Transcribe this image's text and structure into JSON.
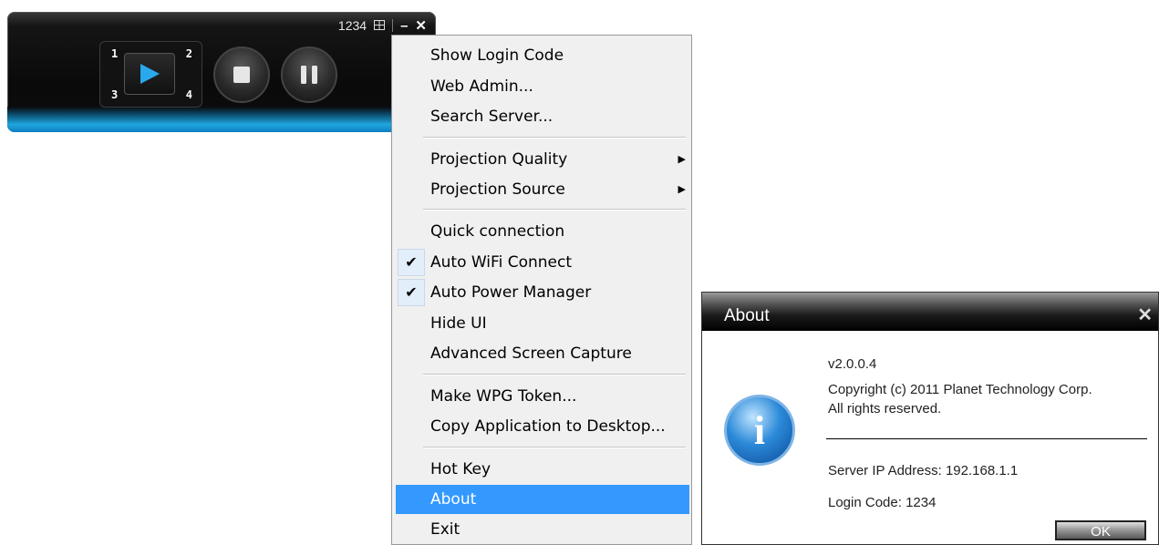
{
  "toolbar": {
    "login_code": "1234",
    "grid_numbers": [
      "1",
      "2",
      "3",
      "4"
    ],
    "accent_color": "#1fa6e0"
  },
  "menu": {
    "items": [
      {
        "label": "Show Login Code"
      },
      {
        "label": "Web Admin..."
      },
      {
        "label": "Search Server..."
      },
      {
        "label": "Projection Quality",
        "submenu": true
      },
      {
        "label": "Projection Source",
        "submenu": true
      },
      {
        "label": "Quick connection"
      },
      {
        "label": "Auto WiFi Connect",
        "checked": true
      },
      {
        "label": "Auto Power Manager",
        "checked": true
      },
      {
        "label": "Hide UI"
      },
      {
        "label": "Advanced Screen Capture"
      },
      {
        "label": "Make WPG Token..."
      },
      {
        "label": "Copy Application to Desktop..."
      },
      {
        "label": "Hot Key"
      },
      {
        "label": "About",
        "selected": true
      },
      {
        "label": "Exit"
      }
    ],
    "selection_color": "#3399ff"
  },
  "about": {
    "title": "About",
    "version": "v2.0.0.4",
    "copyright": "Copyright (c)  2011 Planet Technology Corp.",
    "rights": "All rights reserved.",
    "server_ip": "Server IP Address: 192.168.1.1",
    "login_code": "Login Code: 1234",
    "ok_label": "OK",
    "icon": "info-icon"
  }
}
